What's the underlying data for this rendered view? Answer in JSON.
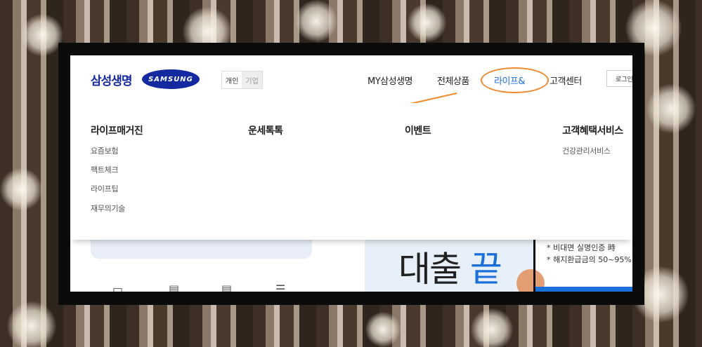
{
  "header": {
    "logo_korean": "삼성생명",
    "logo_brand": "SAMSUNG",
    "segment": {
      "personal": "개인",
      "corporate": "기업"
    },
    "nav": [
      "MY삼성생명",
      "전체상품",
      "라이프&",
      "고객센터"
    ],
    "login_label": "로그인"
  },
  "mega_menu": {
    "columns": [
      {
        "title": "라이프매거진",
        "items": [
          "요즘보험",
          "팩트체크",
          "라이프팁",
          "재무의기술"
        ]
      },
      {
        "title": "운세톡톡",
        "items": []
      },
      {
        "title": "이벤트",
        "items": []
      },
      {
        "title": "고객혜택서비스",
        "items": [
          "건강관리서비스"
        ]
      }
    ]
  },
  "banner": {
    "text_main": "대출",
    "text_highlight": "끝",
    "notes": [
      "* 비대면 실명인증 時",
      "* 해지환급금의 50~95%"
    ]
  },
  "icons": [
    "bag-icon",
    "document-icon",
    "document-icon",
    "stack-icon"
  ],
  "colors": {
    "brand": "#1428a0",
    "active": "#1b6fd9",
    "annotation": "#ef8a30"
  }
}
